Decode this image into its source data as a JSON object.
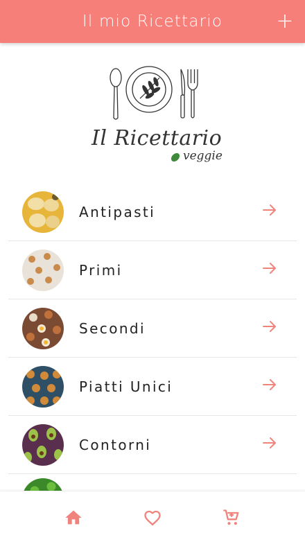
{
  "appbar": {
    "title": "Il mio Ricettario",
    "add_symbol": "+"
  },
  "logo": {
    "title": "Il Ricettario",
    "subtitle": "veggie"
  },
  "categories": [
    {
      "label": "Antipasti"
    },
    {
      "label": "Primi"
    },
    {
      "label": "Secondi"
    },
    {
      "label": "Piatti Unici"
    },
    {
      "label": "Contorni"
    }
  ],
  "colors": {
    "accent": "#f77f7a",
    "arrow": "#f0837c",
    "nav_icon": "#f0837c",
    "leaf": "#3f8a3a"
  },
  "icons": {
    "list_arrow": "arrow-right-icon",
    "nav": [
      "home-icon",
      "heart-icon",
      "cart-icon"
    ]
  }
}
